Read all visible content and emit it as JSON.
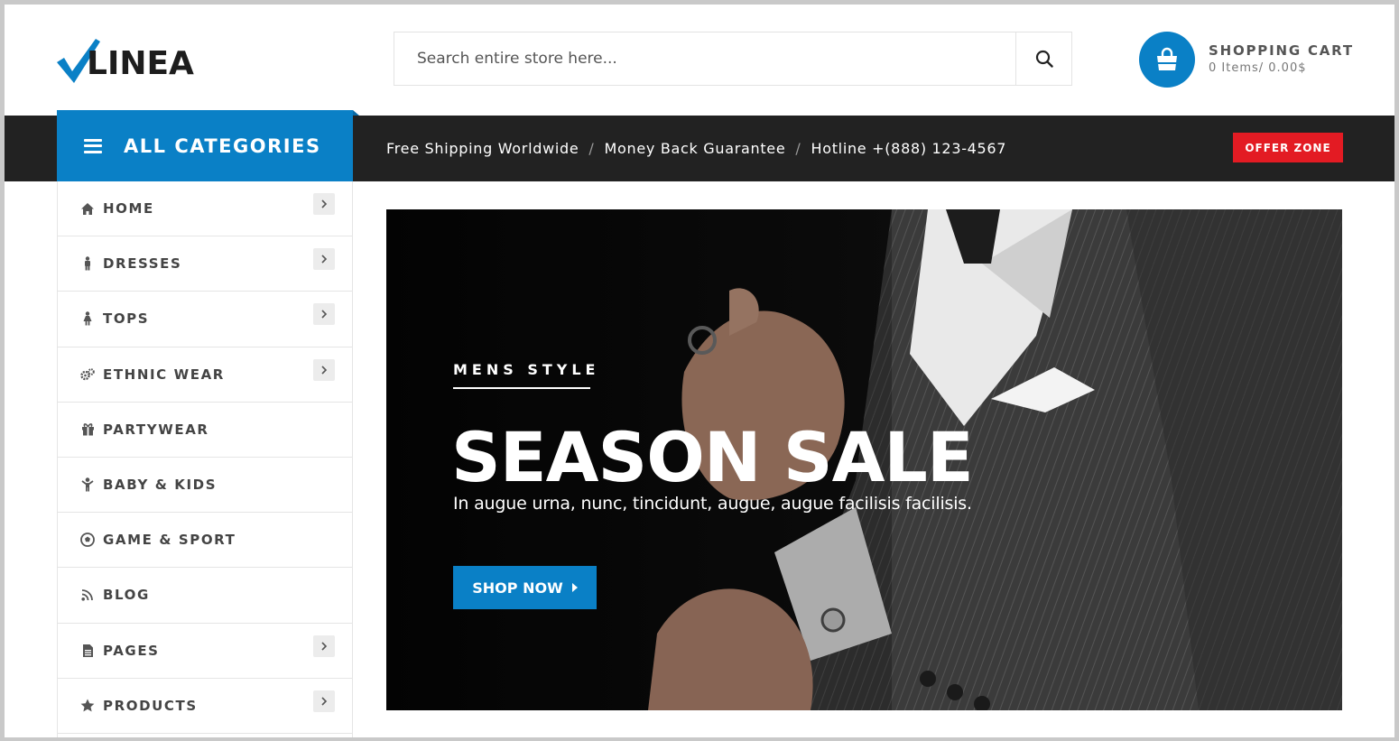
{
  "brand": {
    "logo_text": "LINEA",
    "accent_color": "#0a80c6"
  },
  "search": {
    "placeholder": "Search entire store here...",
    "icon": "search-icon"
  },
  "cart": {
    "title": "SHOPPING CART",
    "summary": "0 Items/ 0.00$",
    "icon": "shopping-bag-icon"
  },
  "nav": {
    "all_categories": "ALL CATEGORIES",
    "promos": [
      "Free Shipping Worldwide",
      "Money Back Guarantee",
      "Hotline +(888) 123-4567"
    ],
    "separator": "/",
    "offer_button": "OFFER ZONE",
    "offer_color": "#e31b23"
  },
  "sidebar": {
    "items": [
      {
        "label": "HOME",
        "icon": "home-icon",
        "has_submenu": true
      },
      {
        "label": "DRESSES",
        "icon": "person-icon",
        "has_submenu": true
      },
      {
        "label": "TOPS",
        "icon": "female-icon",
        "has_submenu": true
      },
      {
        "label": "ETHNIC WEAR",
        "icon": "cogs-icon",
        "has_submenu": true
      },
      {
        "label": "PARTYWEAR",
        "icon": "gift-icon",
        "has_submenu": false
      },
      {
        "label": "BABY & KIDS",
        "icon": "child-icon",
        "has_submenu": false
      },
      {
        "label": "GAME & SPORT",
        "icon": "soccer-ball-icon",
        "has_submenu": false
      },
      {
        "label": "BLOG",
        "icon": "rss-icon",
        "has_submenu": false
      },
      {
        "label": "PAGES",
        "icon": "file-icon",
        "has_submenu": true
      },
      {
        "label": "PRODUCTS",
        "icon": "star-icon",
        "has_submenu": true
      }
    ]
  },
  "banner": {
    "kicker": "MENS STYLE",
    "headline": "SEASON SALE",
    "tagline": "In augue urna, nunc, tincidunt, augue, augue facilisis facilisis.",
    "cta": "SHOP NOW"
  }
}
